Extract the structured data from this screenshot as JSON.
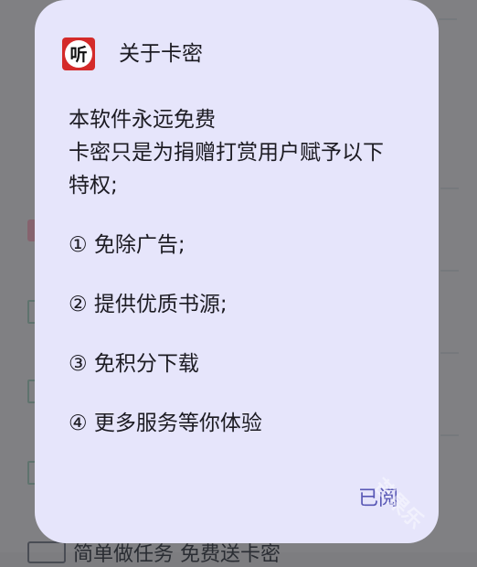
{
  "dialog": {
    "title": "关于卡密",
    "lines": [
      "本软件永远免费",
      "卡密只是为捐赠打赏用户赋予以下",
      "特权;"
    ],
    "items": [
      "① 免除广告;",
      "② 提供优质书源;",
      "③ 免积分下载",
      "④ 更多服务等你体验"
    ],
    "confirm_label": "已阅"
  },
  "app_icon": {
    "name": "app-logo-icon",
    "glyph": "听",
    "color": "#d42a2a"
  },
  "background": {
    "partial_text": "简单做任务 免费送卡密"
  },
  "watermark": {
    "text": "芒果乐"
  },
  "colors": {
    "dialog_bg": "#e6e5fb",
    "accent": "#5857b5",
    "text": "#1c1b22"
  }
}
